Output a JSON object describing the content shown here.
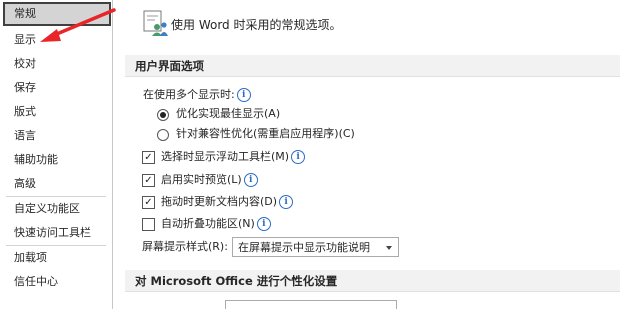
{
  "sidebar": {
    "items": [
      {
        "label": "常规",
        "selected": true
      },
      {
        "label": "显示"
      },
      {
        "label": "校对"
      },
      {
        "label": "保存"
      },
      {
        "label": "版式"
      },
      {
        "label": "语言"
      },
      {
        "label": "辅助功能"
      },
      {
        "label": "高级"
      },
      {
        "label": "自定义功能区"
      },
      {
        "label": "快速访问工具栏"
      },
      {
        "label": "加载项"
      },
      {
        "label": "信任中心"
      }
    ]
  },
  "main": {
    "intro_text": "使用 Word 时采用的常规选项。",
    "ui_section": {
      "title": "用户界面选项",
      "multi_display_label": "在使用多个显示时:",
      "radio_best_display": "优化实现最佳显示(A)",
      "radio_compat": "针对兼容性优化(需重启应用程序)(C)",
      "cb_mini_toolbar": "选择时显示浮动工具栏(M)",
      "cb_live_preview": "启用实时预览(L)",
      "cb_update_drag": "拖动时更新文档内容(D)",
      "cb_collapse_ribbon": "自动折叠功能区(N)",
      "tooltip_style_label": "屏幕提示样式(R):",
      "tooltip_style_value": "在屏幕提示中显示功能说明"
    },
    "office_section": {
      "title": "对 Microsoft Office 进行个性化设置"
    }
  },
  "colors": {
    "accent_blue": "#2b6cc4",
    "annotation_red": "#e8262a",
    "section_bg": "#f2f2f2",
    "selected_bg": "#d4d4d4"
  }
}
